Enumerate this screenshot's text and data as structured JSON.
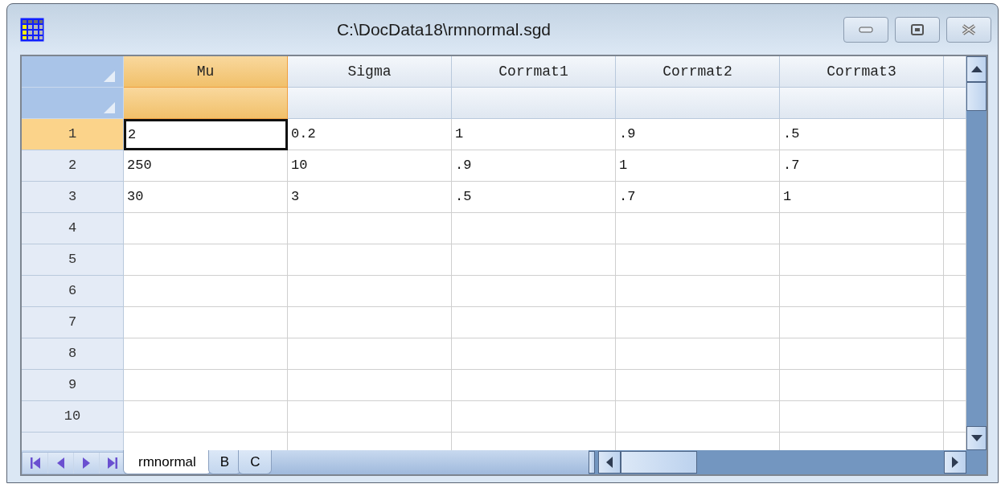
{
  "window": {
    "title": "C:\\DocData18\\rmnormal.sgd"
  },
  "columns": [
    {
      "name": "Mu",
      "selected": true
    },
    {
      "name": "Sigma",
      "selected": false
    },
    {
      "name": "Corrmat1",
      "selected": false
    },
    {
      "name": "Corrmat2",
      "selected": false
    },
    {
      "name": "Corrmat3",
      "selected": false
    }
  ],
  "rows": [
    {
      "label": "1",
      "selected": true,
      "cells": [
        {
          "value": "2",
          "selected": true
        },
        {
          "value": "0.2",
          "selected": false
        },
        {
          "value": "1",
          "selected": false
        },
        {
          "value": ".9",
          "selected": false
        },
        {
          "value": ".5",
          "selected": false
        }
      ]
    },
    {
      "label": "2",
      "selected": false,
      "cells": [
        {
          "value": "250",
          "selected": false
        },
        {
          "value": "10",
          "selected": false
        },
        {
          "value": ".9",
          "selected": false
        },
        {
          "value": "1",
          "selected": false
        },
        {
          "value": ".7",
          "selected": false
        }
      ]
    },
    {
      "label": "3",
      "selected": false,
      "cells": [
        {
          "value": "30",
          "selected": false
        },
        {
          "value": "3",
          "selected": false
        },
        {
          "value": ".5",
          "selected": false
        },
        {
          "value": ".7",
          "selected": false
        },
        {
          "value": "1",
          "selected": false
        }
      ]
    },
    {
      "label": "4",
      "selected": false
    },
    {
      "label": "5",
      "selected": false
    },
    {
      "label": "6",
      "selected": false
    },
    {
      "label": "7",
      "selected": false
    },
    {
      "label": "8",
      "selected": false
    },
    {
      "label": "9",
      "selected": false
    },
    {
      "label": "10",
      "selected": false
    }
  ],
  "sheet_tabs": [
    {
      "label": "rmnormal",
      "selected": true
    },
    {
      "label": "B",
      "selected": false
    },
    {
      "label": "C",
      "selected": false
    }
  ]
}
